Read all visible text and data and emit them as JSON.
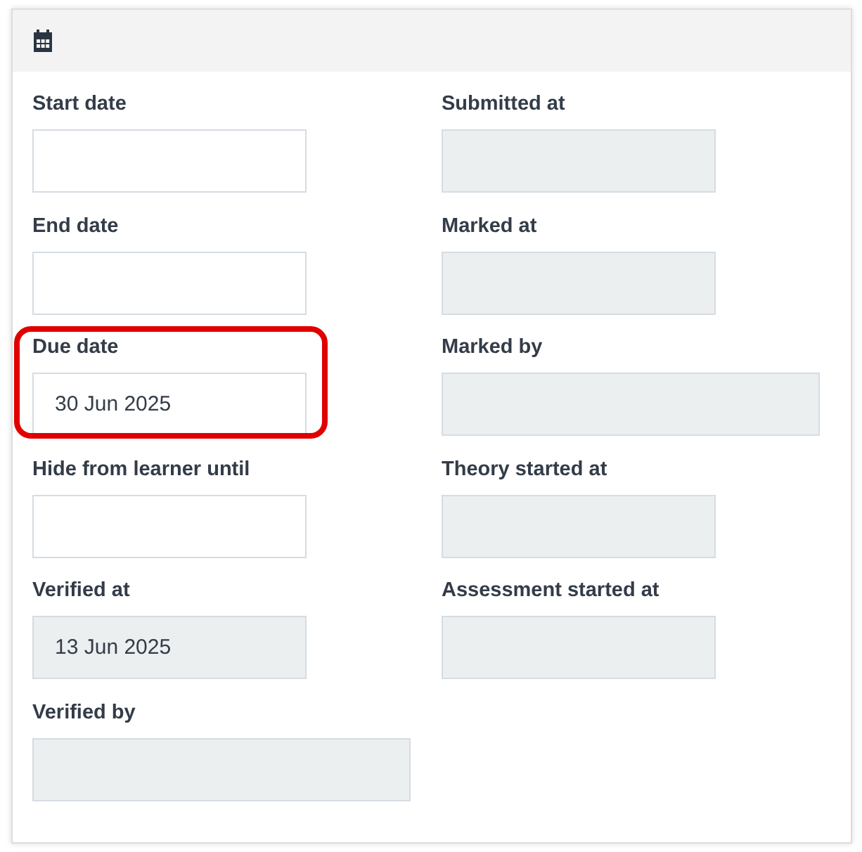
{
  "left_fields": [
    {
      "label": "Start date",
      "disabled": false,
      "wide": false,
      "highlighted": false
    },
    {
      "label": "End date",
      "disabled": false,
      "wide": false,
      "highlighted": false
    },
    {
      "label": "Due date",
      "value": "30 Jun 2025",
      "disabled": false,
      "wide": false,
      "highlighted": true
    },
    {
      "label": "Hide from learner until",
      "disabled": false,
      "wide": false,
      "highlighted": false
    },
    {
      "label": "Verified at",
      "value": "13 Jun 2025",
      "disabled": true,
      "wide": false,
      "highlighted": false
    },
    {
      "label": "Verified by",
      "disabled": true,
      "wide": true,
      "highlighted": false
    }
  ],
  "right_fields": [
    {
      "label": "Submitted at",
      "disabled": true,
      "wide": false,
      "highlighted": false
    },
    {
      "label": "Marked at",
      "disabled": true,
      "wide": false,
      "highlighted": false
    },
    {
      "label": "Marked by",
      "disabled": true,
      "wide": true,
      "highlighted": false
    },
    {
      "label": "Theory started at",
      "disabled": true,
      "wide": false,
      "highlighted": false
    },
    {
      "label": "Assessment started at",
      "disabled": true,
      "wide": false,
      "highlighted": false
    }
  ]
}
